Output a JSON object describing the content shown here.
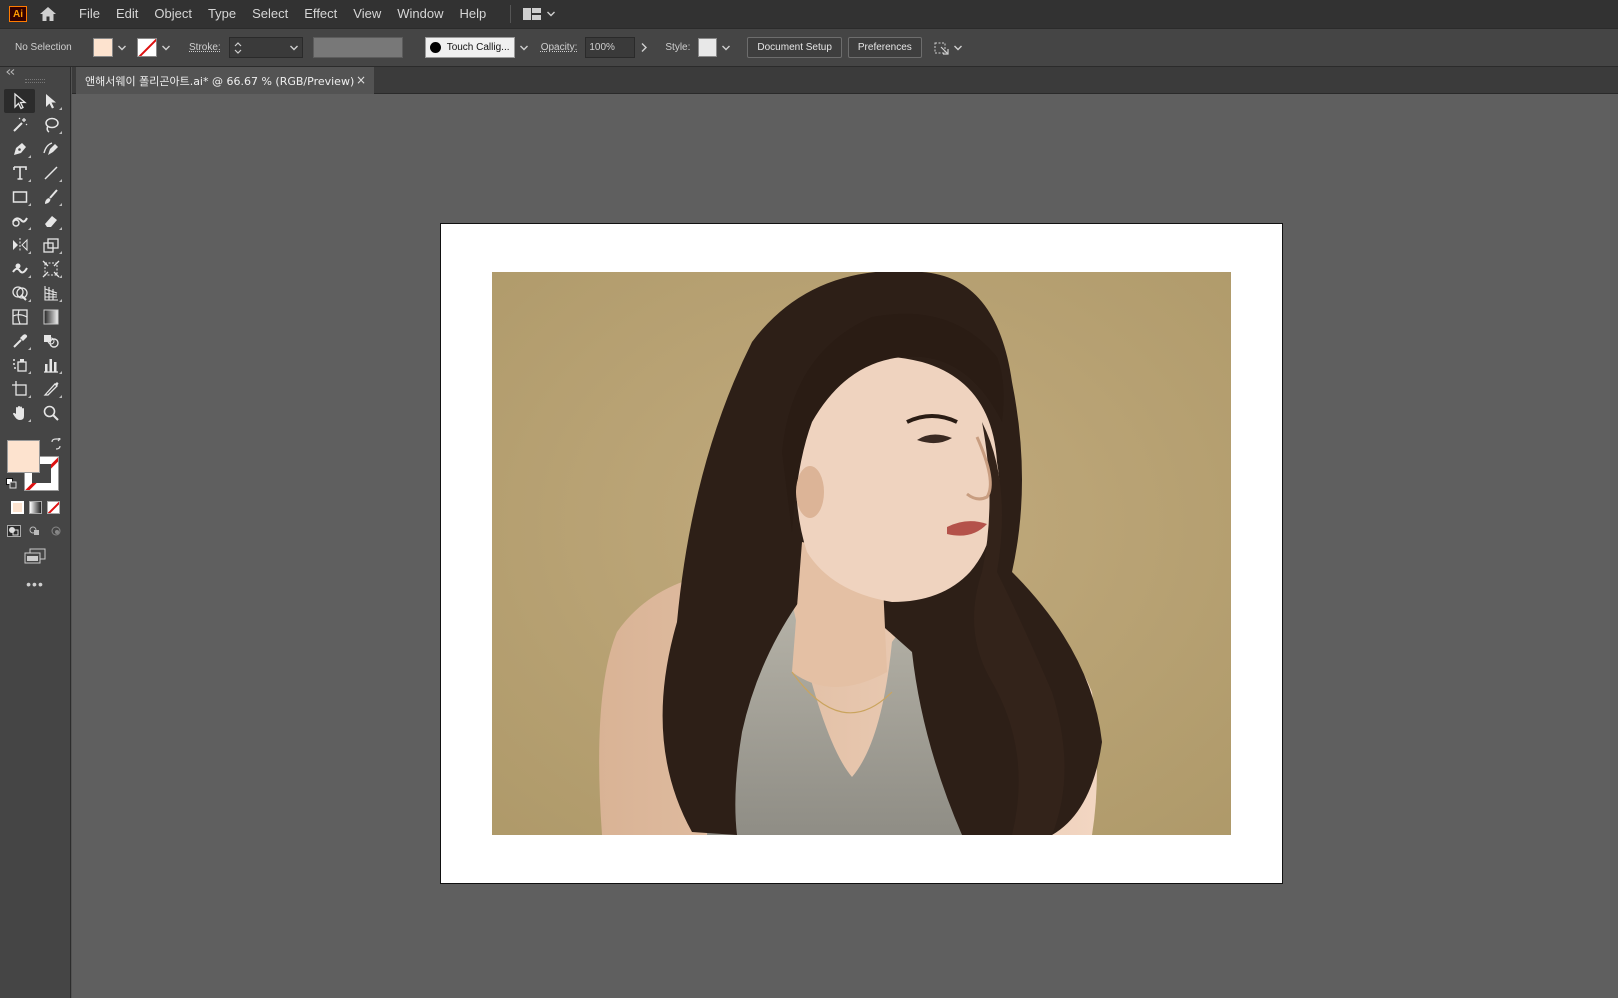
{
  "app": {
    "logo_text": "Ai",
    "accent_color": "#ff9a00"
  },
  "menu": {
    "items": [
      "File",
      "Edit",
      "Object",
      "Type",
      "Select",
      "Effect",
      "View",
      "Window",
      "Help"
    ]
  },
  "control_bar": {
    "selection_status": "No Selection",
    "fill_color": "#fde3cf",
    "stroke_label": "Stroke:",
    "brush_name": "Touch Callig...",
    "opacity_label": "Opacity:",
    "opacity_value": "100%",
    "style_label": "Style:",
    "document_setup_label": "Document Setup",
    "preferences_label": "Preferences"
  },
  "toolbar": {
    "tools": [
      "selection-tool",
      "direct-selection-tool",
      "magic-wand-tool",
      "lasso-tool",
      "pen-tool",
      "curvature-tool",
      "type-tool",
      "line-segment-tool",
      "rectangle-tool",
      "paintbrush-tool",
      "shaper-tool",
      "eraser-tool",
      "reflect-tool",
      "scale-tool",
      "warp-tool",
      "free-transform-tool",
      "shape-builder-tool",
      "perspective-grid-tool",
      "mesh-tool",
      "gradient-tool",
      "eyedropper-tool",
      "blend-tool",
      "symbol-sprayer-tool",
      "column-graph-tool",
      "artboard-tool",
      "slice-tool",
      "hand-tool",
      "zoom-tool"
    ],
    "more_label": "•••"
  },
  "document": {
    "tab_title": "앤해서웨이 폴리곤아트.ai* @ 66.67 % (RGB/Preview)",
    "close_label": "×"
  },
  "artwork": {
    "background_color": "#bda679",
    "hair_color": "#2d1f17",
    "skin_color": "#e9c6ac",
    "top_color": "#a9a69b"
  }
}
